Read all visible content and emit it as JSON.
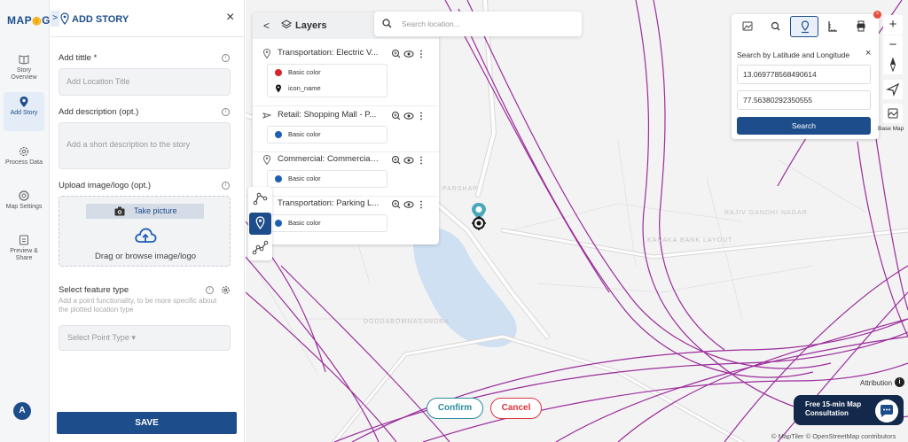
{
  "app": {
    "logo": "MAPOG"
  },
  "rail": {
    "items": [
      {
        "label": "Story Overview",
        "icon": "book-icon"
      },
      {
        "label": "Add Story",
        "icon": "location-pin-icon",
        "active": true
      },
      {
        "label": "Process Data",
        "icon": "gear-icon"
      },
      {
        "label": "Map Settings",
        "icon": "settings-icon"
      },
      {
        "label": "Preview & Share",
        "icon": "share-icon"
      }
    ],
    "avatar": "A"
  },
  "panel": {
    "title": "ADD STORY",
    "collapse": ">",
    "close": "×",
    "title_label": "Add tittle *",
    "title_placeholder": "Add Location Title",
    "desc_label": "Add description (opt.)",
    "desc_placeholder": "Add a short description to the story",
    "upload_label": "Upload image/logo (opt.)",
    "take_picture": "Take picture",
    "drag_text": "Drag or browse image/logo",
    "feature_label": "Select feature type",
    "feature_hint": "Add a point functionality, to be more specific about the plotted location type",
    "feature_select": "Select Point Type ▾",
    "save": "SAVE",
    "info": "i"
  },
  "layers": {
    "title": "Layers",
    "back": "<",
    "items": [
      {
        "name": "Transportation: Electric V...",
        "type": "point",
        "styles": [
          {
            "kind": "dot",
            "color": "#d6252e",
            "label": "Basic color"
          },
          {
            "kind": "pin",
            "color": "#111111",
            "label": "icon_name"
          }
        ]
      },
      {
        "name": "Retail: Shopping Mall - P...",
        "type": "plane",
        "styles": [
          {
            "kind": "dot",
            "color": "#1e5fb4",
            "label": "Basic color"
          }
        ]
      },
      {
        "name": "Commercial: Commercial ...",
        "type": "point",
        "styles": [
          {
            "kind": "dot",
            "color": "#1e5fb4",
            "label": "Basic color"
          }
        ]
      },
      {
        "name": "Transportation: Parking L...",
        "type": "point",
        "styles": [
          {
            "kind": "dot",
            "color": "#1e5fb4",
            "label": "Basic color"
          }
        ]
      }
    ]
  },
  "search": {
    "placeholder": "Search location..."
  },
  "coords": {
    "title": "Search by Latitude and Longitude",
    "close": "×",
    "latitude": "13.069778568490614",
    "longitude": "77.56380292350555",
    "search": "Search",
    "badge": "×"
  },
  "map": {
    "labels": {
      "area1": "RAJIV GANDHI NAGAR",
      "area2": "KANAKA BANK LAYOUT",
      "area3": "DODDABOMMASANDRA",
      "area4": "PARSHAP"
    },
    "controls": {
      "zoom_in": "+",
      "zoom_out": "−",
      "base_map": "Base Map"
    },
    "confirm": "Confirm",
    "cancel": "Cancel",
    "attribution": "Attribution",
    "attr_icon": "i",
    "consult_line1": "Free 15-min Map",
    "consult_line2": "Consultation",
    "copyright": "© MapTiler © OpenStreetMap contributors",
    "route_color": "#9b2d9b",
    "water_color": "#cfe0f3"
  }
}
